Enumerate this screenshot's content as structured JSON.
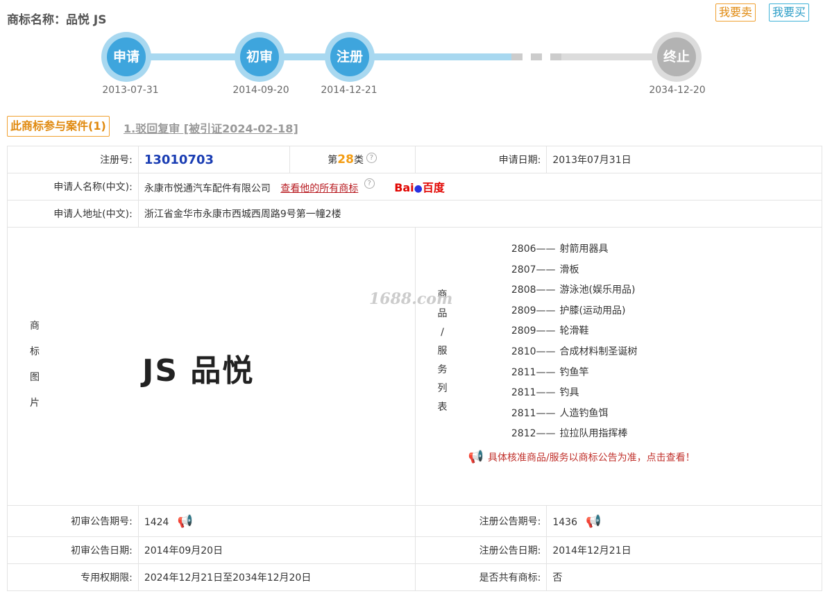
{
  "header": {
    "title": "商标名称：品悦 JS",
    "sell_label": "我要卖",
    "buy_label": "我要买"
  },
  "timeline": {
    "steps": [
      {
        "label": "申请",
        "date": "2013-07-31",
        "state": "done"
      },
      {
        "label": "初审",
        "date": "2014-09-20",
        "state": "done"
      },
      {
        "label": "注册",
        "date": "2014-12-21",
        "state": "done"
      },
      {
        "label": "终止",
        "date": "2034-12-20",
        "state": "future"
      }
    ],
    "colors": {
      "done": "#3ea5dd",
      "future": "#b3b3b3"
    }
  },
  "cases": {
    "tab_label": "此商标参与案件(1)",
    "case_link": "1.驳回复审 [被引证2024-02-18]"
  },
  "info": {
    "reg_no_label": "注册号:",
    "reg_no": "13010703",
    "class_prefix": "第",
    "class_num": "28",
    "class_suffix": "类",
    "apply_date_label": "申请日期:",
    "apply_date": "2013年07月31日",
    "applicant_label": "申请人名称(中文):",
    "applicant": "永康市悦通汽车配件有限公司",
    "all_marks_link": "查看他的所有商标",
    "baidu_label": "Bai",
    "baidu_cn": "百度",
    "address_label": "申请人地址(中文):",
    "address": "浙江省金华市永康市西城西周路9号第一幢2楼",
    "image_label_chars": [
      "商",
      "标",
      "图",
      "片"
    ],
    "mark_text": "JS 品悦",
    "goods_label_chars": [
      "商",
      "品",
      "/",
      "服",
      "务",
      "列",
      "表"
    ],
    "goods": [
      {
        "code": "2806",
        "name": "射箭用器具"
      },
      {
        "code": "2807",
        "name": "滑板"
      },
      {
        "code": "2808",
        "name": "游泳池(娱乐用品)"
      },
      {
        "code": "2809",
        "name": "护膝(运动用品)"
      },
      {
        "code": "2809",
        "name": "轮滑鞋"
      },
      {
        "code": "2810",
        "name": "合成材料制圣诞树"
      },
      {
        "code": "2811",
        "name": "钓鱼竿"
      },
      {
        "code": "2811",
        "name": "钓具"
      },
      {
        "code": "2811",
        "name": "人造钓鱼饵"
      },
      {
        "code": "2812",
        "name": "拉拉队用指挥棒"
      }
    ],
    "goods_dash": "——",
    "goods_notice": "具体核准商品/服务以商标公告为准，点击查看！",
    "watermark": "1688.com",
    "prelim_no_label": "初审公告期号:",
    "prelim_no": "1424",
    "reg_pub_no_label": "注册公告期号:",
    "reg_pub_no": "1436",
    "prelim_date_label": "初审公告日期:",
    "prelim_date": "2014年09月20日",
    "reg_pub_date_label": "注册公告日期:",
    "reg_pub_date": "2014年12月21日",
    "term_label": "专用权期限:",
    "term": "2024年12月21日至2034年12月20日",
    "shared_label": "是否共有商标:",
    "shared": "否"
  }
}
